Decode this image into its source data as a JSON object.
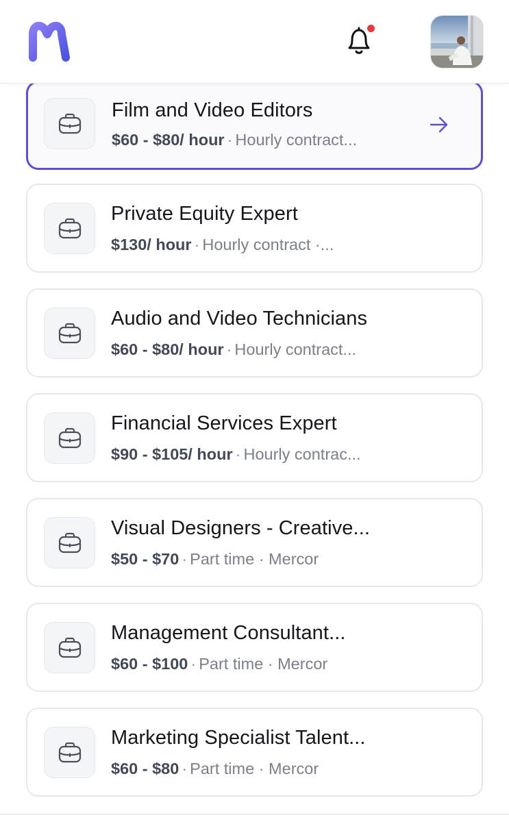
{
  "app": {
    "logo_name": "M",
    "accent_color": "#5c50cf",
    "notification_color": "#e23c3c"
  },
  "jobs": [
    {
      "title": "Film and Video Editors",
      "pay": "$60 - $80/ hour",
      "details": "Hourly contract...",
      "active": true,
      "icon": "briefcase-icon"
    },
    {
      "title": "Private Equity Expert",
      "pay": "$130/ hour",
      "details": "Hourly contract ·...",
      "active": false,
      "icon": "briefcase-icon"
    },
    {
      "title": "Audio and Video Technicians",
      "pay": "$60 - $80/ hour",
      "details": "Hourly contract...",
      "active": false,
      "icon": "briefcase-icon"
    },
    {
      "title": "Financial Services Expert",
      "pay": "$90 - $105/ hour",
      "details": "Hourly contrac...",
      "active": false,
      "icon": "briefcase-icon"
    },
    {
      "title": "Visual Designers - Creative...",
      "pay": "$50 - $70",
      "details": "Part time · Mercor",
      "active": false,
      "icon": "briefcase-icon"
    },
    {
      "title": "Management Consultant...",
      "pay": "$60 - $100",
      "details": "Part time · Mercor",
      "active": false,
      "icon": "briefcase-icon"
    },
    {
      "title": "Marketing Specialist Talent...",
      "pay": "$60 - $80",
      "details": "Part time · Mercor",
      "active": false,
      "icon": "briefcase-icon"
    }
  ]
}
